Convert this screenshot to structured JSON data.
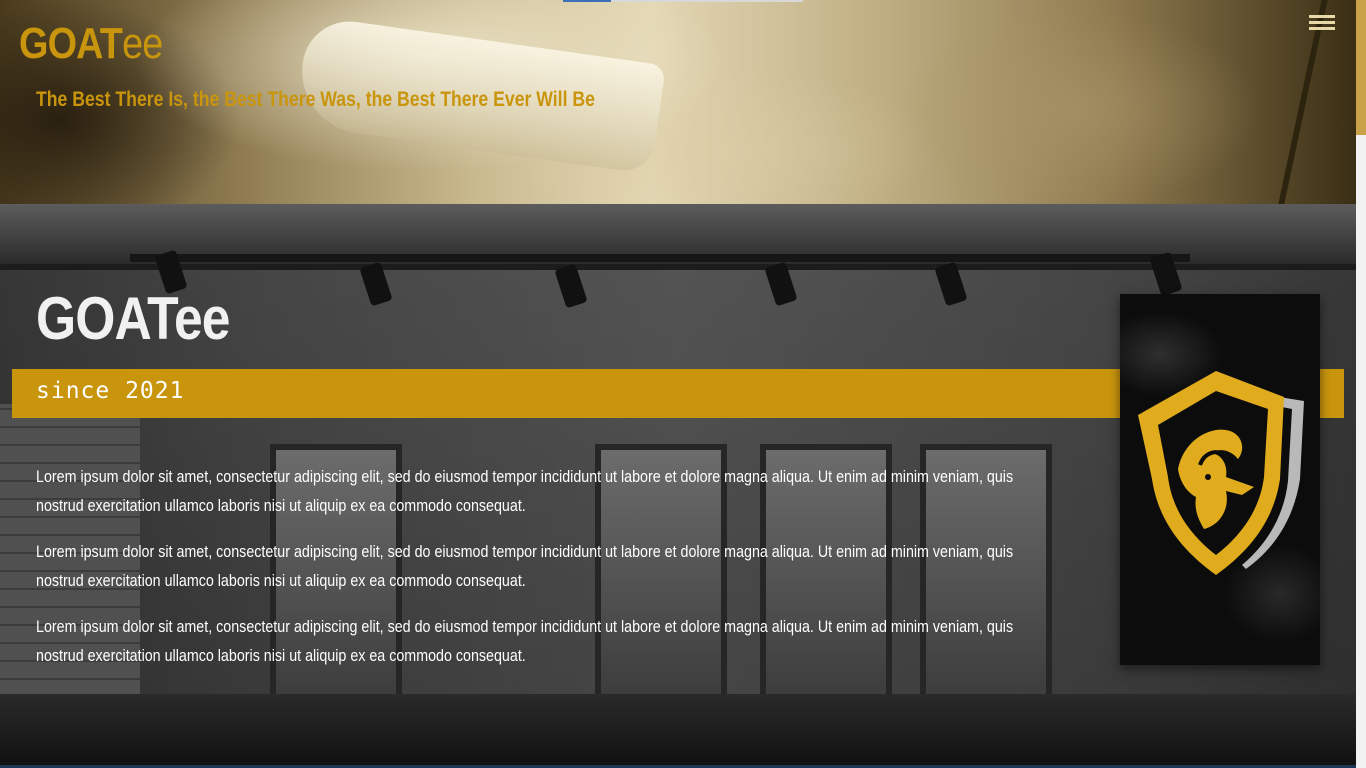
{
  "header": {
    "brand_bold": "GOAT",
    "brand_light": "ee",
    "tagline": "The Best There Is, the Best There Was, the Best There Ever Will Be",
    "menu_icon": "hamburger-menu-icon"
  },
  "about": {
    "title": "GOATee",
    "since": "since 2021",
    "paragraphs": [
      "Lorem ipsum dolor sit amet, consectetur adipiscing elit, sed do eiusmod tempor incididunt ut labore et dolore magna aliqua. Ut enim ad minim veniam, quis nostrud exercitation ullamco laboris nisi ut aliquip ex ea commodo consequat.",
      "Lorem ipsum dolor sit amet, consectetur adipiscing elit, sed do eiusmod tempor incididunt ut labore et dolore magna aliqua. Ut enim ad minim veniam, quis nostrud exercitation ullamco laboris nisi ut aliquip ex ea commodo consequat.",
      "Lorem ipsum dolor sit amet, consectetur adipiscing elit, sed do eiusmod tempor incididunt ut labore et dolore magna aliqua. Ut enim ad minim veniam, quis nostrud exercitation ullamco laboris nisi ut aliquip ex ea commodo consequat."
    ],
    "logo_icon": "goat-shield-logo-icon"
  },
  "colors": {
    "accent": "#c9950c",
    "text_light": "#ffffff",
    "logo_gold": "#e0ab1c",
    "logo_silver": "#b9b9b9"
  }
}
